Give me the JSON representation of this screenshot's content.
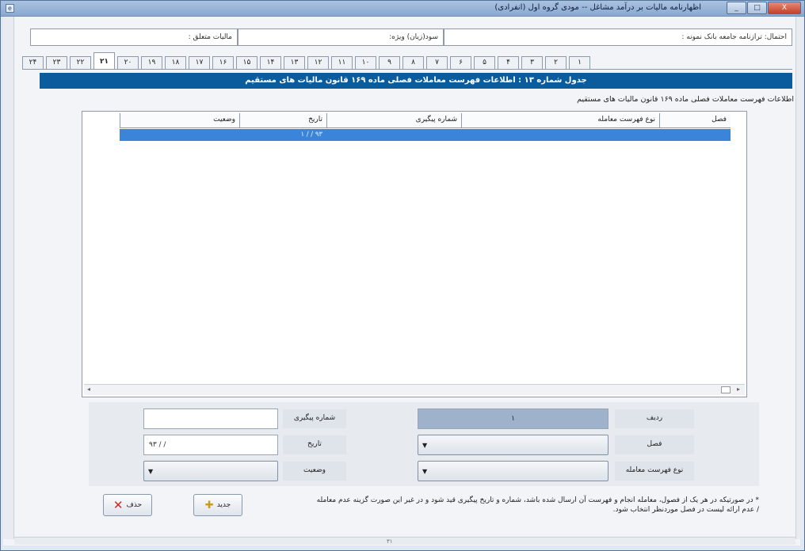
{
  "window": {
    "title": "اظهارنامه مالیات بر درآمد مشاغل -- مودی گروه اول (انفرادی)",
    "icon": "app-icon",
    "buttons": {
      "minimize": "_",
      "maximize": "□",
      "close": "X"
    }
  },
  "info": {
    "total_income": "احتمال: ترازنامه جامعه بانک نمونه :",
    "taxable": "سود(زیان) ویژه:",
    "tax_due": "مالیات متعلق :"
  },
  "tabs": [
    "۲۴",
    "۲۳",
    "۲۲",
    "۲۱",
    "۲۰",
    "۱۹",
    "۱۸",
    "۱۷",
    "۱۶",
    "۱۵",
    "۱۴",
    "۱۳",
    "۱۲",
    "۱۱",
    "۱۰",
    "۹",
    "۸",
    "۷",
    "۶",
    "۵",
    "۴",
    "۳",
    "۲",
    "۱"
  ],
  "active_tab_index": 3,
  "banner": "جدول شماره ۱۳ : اطلاعات فهرست معاملات فصلی ماده ۱۶۹ قانون مالیات های مستقیم",
  "subtitle": "اطلاعات فهرست معاملات فصلی ماده ۱۶۹ قانون مالیات های مستقیم",
  "grid": {
    "columns": [
      "فصل",
      "نوع فهرست معامله",
      "شماره پیگیری",
      "تاریخ",
      "وضعیت"
    ],
    "rows": [
      {
        "season": "",
        "type": "",
        "tracking": "",
        "date": "۹۳ / / ۱",
        "status": ""
      }
    ]
  },
  "form": {
    "row_label": "ردیف",
    "row_value": "۱",
    "season_label": "فصل",
    "season_value": "",
    "type_label": "نوع فهرست معامله",
    "type_value": "",
    "tracking_label": "شماره پیگیری",
    "tracking_value": "",
    "date_label": "تاریخ",
    "date_value": "۹۳ / /",
    "status_label": "وضعیت",
    "status_value": ""
  },
  "actions": {
    "delete": "حذف",
    "new": "جدید"
  },
  "note": "* در صورتیکه در هر یک از فصول، معامله انجام و فهرست آن ارسال شده باشد، شماره و تاریخ پیگیری قید شود و در غیر این صورت گزینه عدم معامله / عدم ارائه لیست در فصل موردنظر انتخاب شود.",
  "status": {
    "page": "۳۱"
  }
}
